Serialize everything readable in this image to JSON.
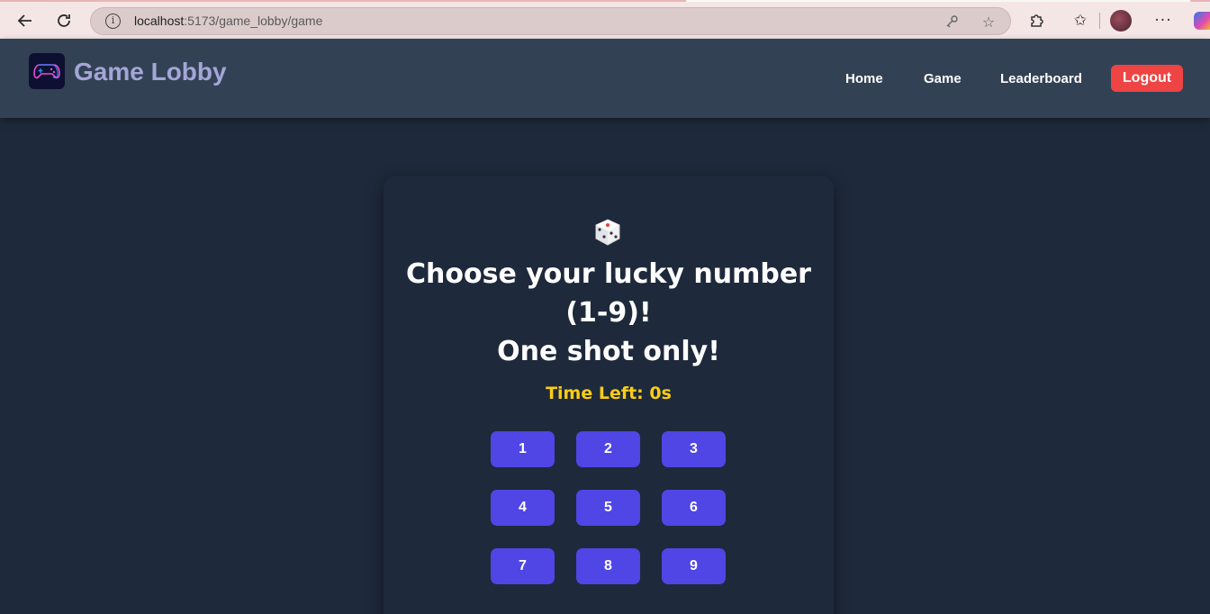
{
  "browser": {
    "url_host": "localhost",
    "url_path": ":5173/game_lobby/game",
    "icons": [
      "back-arrow-icon",
      "refresh-icon",
      "site-info-icon",
      "key-icon",
      "favorite-star-icon",
      "extensions-icon",
      "favorites-icon",
      "profile-avatar",
      "more-icon",
      "copilot-icon"
    ]
  },
  "navbar": {
    "brand": "Game Lobby",
    "links": [
      "Home",
      "Game",
      "Leaderboard"
    ],
    "logout": "Logout"
  },
  "game": {
    "title_line1": "Choose your lucky number",
    "title_line2": "(1-9)!",
    "title_line3": "One shot only!",
    "timer": "Time Left: 0s",
    "numbers": [
      "1",
      "2",
      "3",
      "4",
      "5",
      "6",
      "7",
      "8",
      "9"
    ]
  },
  "colors": {
    "background": "#1e293b",
    "navbar": "#334155",
    "brand": "#a3a6d6",
    "accent_button": "#4f46e5",
    "logout": "#ef4444",
    "timer": "#facc15"
  }
}
